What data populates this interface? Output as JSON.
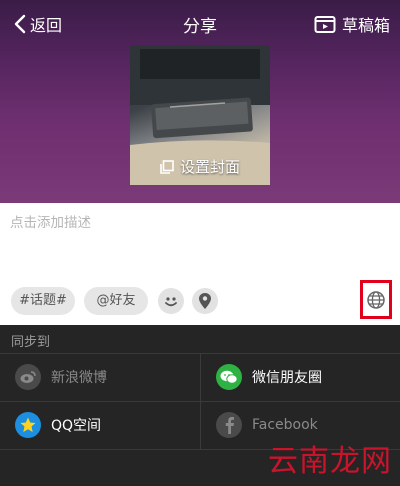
{
  "nav": {
    "back_label": "返回",
    "title": "分享",
    "drafts_label": "草稿箱"
  },
  "cover": {
    "caption": "设置封面"
  },
  "description": {
    "placeholder": "点击添加描述"
  },
  "tags": {
    "topic": "#话题#",
    "friend": "@好友"
  },
  "sync": {
    "label": "同步到",
    "targets": [
      {
        "name": "新浪微博",
        "enabled": false,
        "icon": "weibo-icon"
      },
      {
        "name": "微信朋友圈",
        "enabled": true,
        "icon": "wechat-moments-icon"
      },
      {
        "name": "QQ空间",
        "enabled": true,
        "icon": "qzone-icon"
      },
      {
        "name": "Facebook",
        "enabled": false,
        "icon": "facebook-icon"
      }
    ]
  },
  "watermark": "云南龙网",
  "colors": {
    "highlight_box": "#e0001b",
    "wechat": "#2fb244",
    "qzone": "#1c8fe0",
    "panel": "#252525"
  }
}
